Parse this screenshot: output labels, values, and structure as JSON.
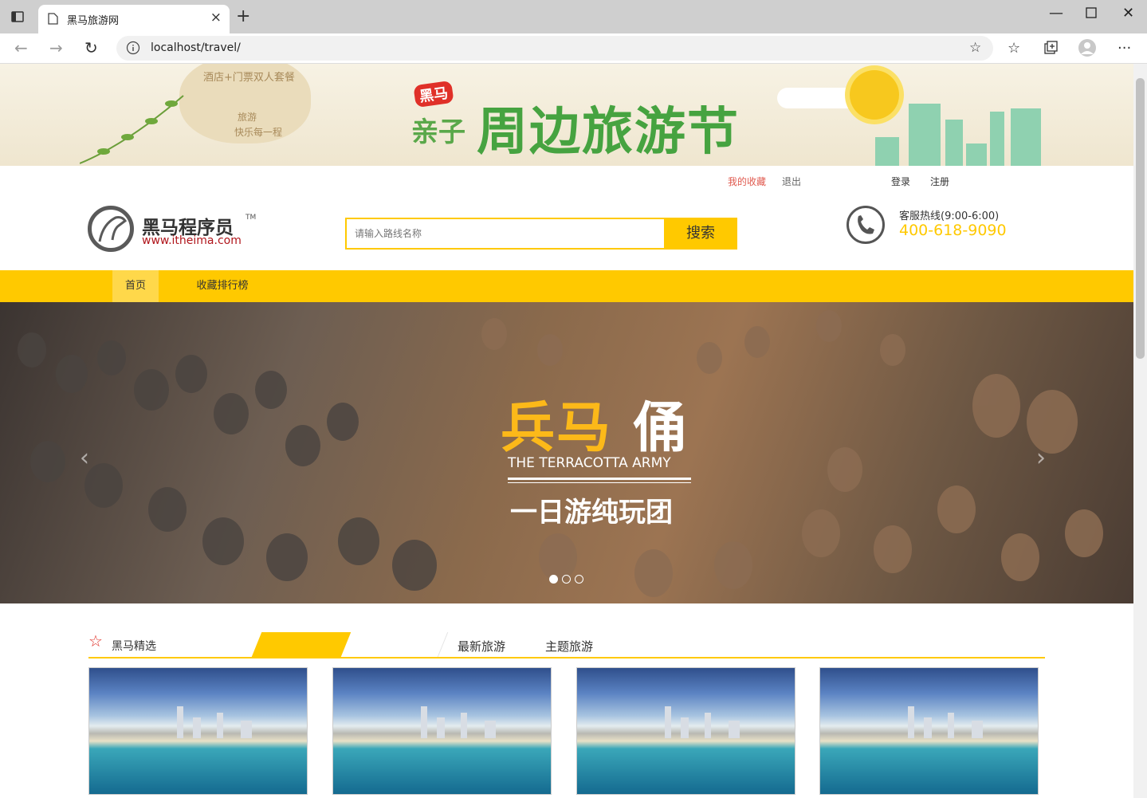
{
  "browser": {
    "tab_title": "黑马旅游网",
    "url": "localhost/travel/"
  },
  "banner": {
    "line1": "酒店+门票双人套餐",
    "line2": "旅游",
    "line3": "快乐每一程",
    "brand": "黑马",
    "qinzi": "亲子",
    "title": "周边旅游节"
  },
  "header": {
    "links": {
      "favorites": "我的收藏",
      "logout": "退出",
      "login": "登录",
      "register": "注册"
    },
    "logo_name": "黑马程序员",
    "logo_tm": "TM",
    "logo_url": "www.itheima.com",
    "search_placeholder": "请输入路线名称",
    "search_button": "搜索",
    "hotline_label": "客服热线(9:00-6:00)",
    "phone": "400-618-9090"
  },
  "nav": {
    "items": [
      "首页",
      "收藏排行榜"
    ]
  },
  "carousel": {
    "title_yellow": "兵马",
    "title_white": "俑",
    "subtitle_en": "THE TERRACOTTA ARMY",
    "subtitle_cn": "一日游纯玩团",
    "prev": "‹",
    "next": "›",
    "slide_count": 3,
    "active_slide": 1
  },
  "section": {
    "title": "黑马精选",
    "tabs": [
      "最新旅游",
      "主题旅游"
    ]
  },
  "colors": {
    "accent": "#ffc900",
    "brand_red": "#b0151b",
    "link_red": "#e05a4f"
  }
}
